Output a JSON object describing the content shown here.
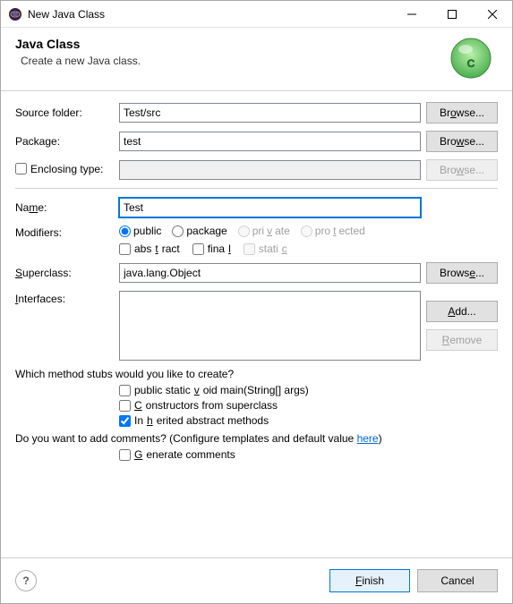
{
  "window": {
    "title": "New Java Class"
  },
  "banner": {
    "heading": "Java Class",
    "subtitle": "Create a new Java class."
  },
  "labels": {
    "source_folder": "Source folder:",
    "package": "Package:",
    "enclosing_type": "Enclosing type:",
    "name": "Name:",
    "modifiers": "Modifiers:",
    "superclass": "Superclass:",
    "interfaces": "Interfaces:"
  },
  "values": {
    "source_folder": "Test/src",
    "package": "test",
    "enclosing_type": "",
    "name": "Test",
    "superclass": "java.lang.Object"
  },
  "modifiers": {
    "visibility": {
      "public": "public",
      "package": "package",
      "private": "private",
      "protected": "protected",
      "selected": "public"
    },
    "abstract": "abstract",
    "final": "final",
    "static": "static"
  },
  "buttons": {
    "browse": "Browse...",
    "add": "Add...",
    "remove": "Remove",
    "finish": "Finish",
    "cancel": "Cancel"
  },
  "stubs": {
    "question": "Which method stubs would you like to create?",
    "main": "public static void main(String[] args)",
    "constructors": "Constructors from superclass",
    "inherited": "Inherited abstract methods"
  },
  "comments": {
    "question_prefix": "Do you want to add comments? (Configure templates and default value ",
    "link": "here",
    "question_suffix": ")",
    "generate": "Generate comments"
  }
}
